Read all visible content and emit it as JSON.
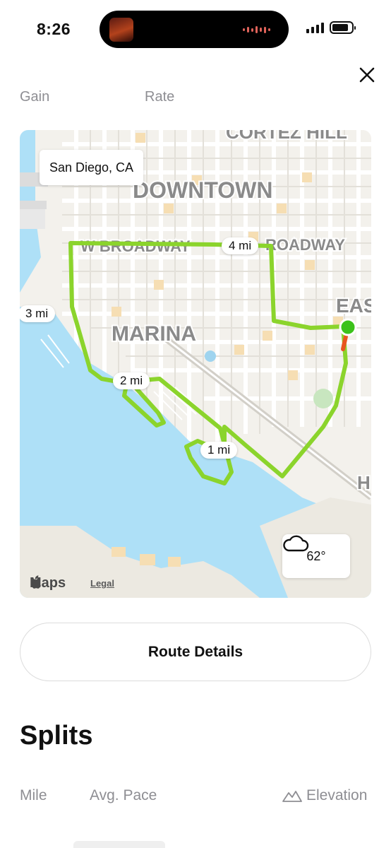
{
  "status_bar": {
    "time": "8:26"
  },
  "partial_labels": [
    "Gain",
    "Rate"
  ],
  "map": {
    "location": "San Diego, CA",
    "districts": [
      "CORTEZ HILL",
      "DOWNTOWN",
      "MARINA",
      "EAS",
      "H"
    ],
    "streets": [
      "W BROADWAY",
      "ROADWAY"
    ],
    "mile_markers": [
      "1 mi",
      "2 mi",
      "3 mi",
      "4 mi"
    ],
    "weather": {
      "temp": "62°",
      "icon": "cloud-icon"
    },
    "attribution": {
      "brand": "Maps",
      "legal": "Legal"
    },
    "colors": {
      "route": "#8bd42c",
      "water": "#aee0f7",
      "start": "#3cc21b",
      "end": "#e8551f"
    }
  },
  "route_details_label": "Route Details",
  "splits": {
    "title": "Splits",
    "columns": {
      "mile": "Mile",
      "pace": "Avg. Pace",
      "elevation": "Elevation"
    }
  }
}
